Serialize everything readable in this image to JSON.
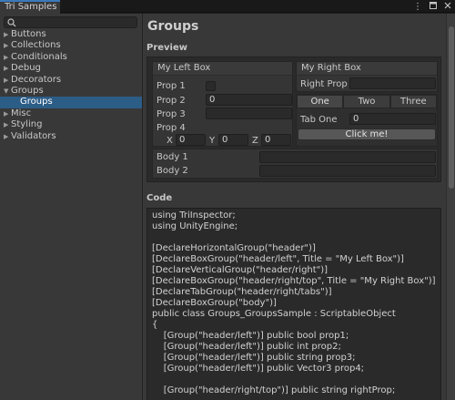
{
  "window": {
    "tab_title": "Tri Samples",
    "menu_icon": "kebab-menu-icon",
    "maximize_icon": "maximize-icon",
    "close_icon": "close-icon"
  },
  "sidebar": {
    "search": {
      "value": "",
      "placeholder": ""
    },
    "items": [
      {
        "label": "Buttons",
        "expanded": false,
        "child": false,
        "selected": false
      },
      {
        "label": "Collections",
        "expanded": false,
        "child": false,
        "selected": false
      },
      {
        "label": "Conditionals",
        "expanded": false,
        "child": false,
        "selected": false
      },
      {
        "label": "Debug",
        "expanded": false,
        "child": false,
        "selected": false
      },
      {
        "label": "Decorators",
        "expanded": false,
        "child": false,
        "selected": false
      },
      {
        "label": "Groups",
        "expanded": true,
        "child": false,
        "selected": false
      },
      {
        "label": "Groups",
        "expanded": false,
        "child": true,
        "selected": true
      },
      {
        "label": "Misc",
        "expanded": false,
        "child": false,
        "selected": false
      },
      {
        "label": "Styling",
        "expanded": false,
        "child": false,
        "selected": false
      },
      {
        "label": "Validators",
        "expanded": false,
        "child": false,
        "selected": false
      }
    ]
  },
  "main": {
    "title": "Groups",
    "preview_label": "Preview",
    "code_label": "Code",
    "left_box": {
      "title": "My Left Box",
      "prop1_label": "Prop 1",
      "prop1_checked": false,
      "prop2_label": "Prop 2",
      "prop2_value": "0",
      "prop3_label": "Prop 3",
      "prop3_value": "",
      "prop4_label": "Prop 4",
      "x_label": "X",
      "x_value": "0",
      "y_label": "Y",
      "y_value": "0",
      "z_label": "Z",
      "z_value": "0"
    },
    "right_box": {
      "title": "My Right Box",
      "right_prop_label": "Right Prop",
      "right_prop_value": "",
      "tabs": [
        "One",
        "Two",
        "Three"
      ],
      "active_tab": "One",
      "tab_one_label": "Tab One",
      "tab_one_value": "0",
      "button_label": "Click me!"
    },
    "body_box": {
      "body1_label": "Body 1",
      "body1_value": "",
      "body2_label": "Body 2",
      "body2_value": ""
    },
    "code_lines": [
      "using TriInspector;",
      "using UnityEngine;",
      "",
      "[DeclareHorizontalGroup(\"header\")]",
      "[DeclareBoxGroup(\"header/left\", Title = \"My Left Box\")]",
      "[DeclareVerticalGroup(\"header/right\")]",
      "[DeclareBoxGroup(\"header/right/top\", Title = \"My Right Box\")]",
      "[DeclareTabGroup(\"header/right/tabs\")]",
      "[DeclareBoxGroup(\"body\")]",
      "public class Groups_GroupsSample : ScriptableObject",
      "{",
      "    [Group(\"header/left\")] public bool prop1;",
      "    [Group(\"header/left\")] public int prop2;",
      "    [Group(\"header/left\")] public string prop3;",
      "    [Group(\"header/left\")] public Vector3 prop4;",
      "",
      "    [Group(\"header/right/top\")] public string rightProp;",
      ""
    ]
  }
}
